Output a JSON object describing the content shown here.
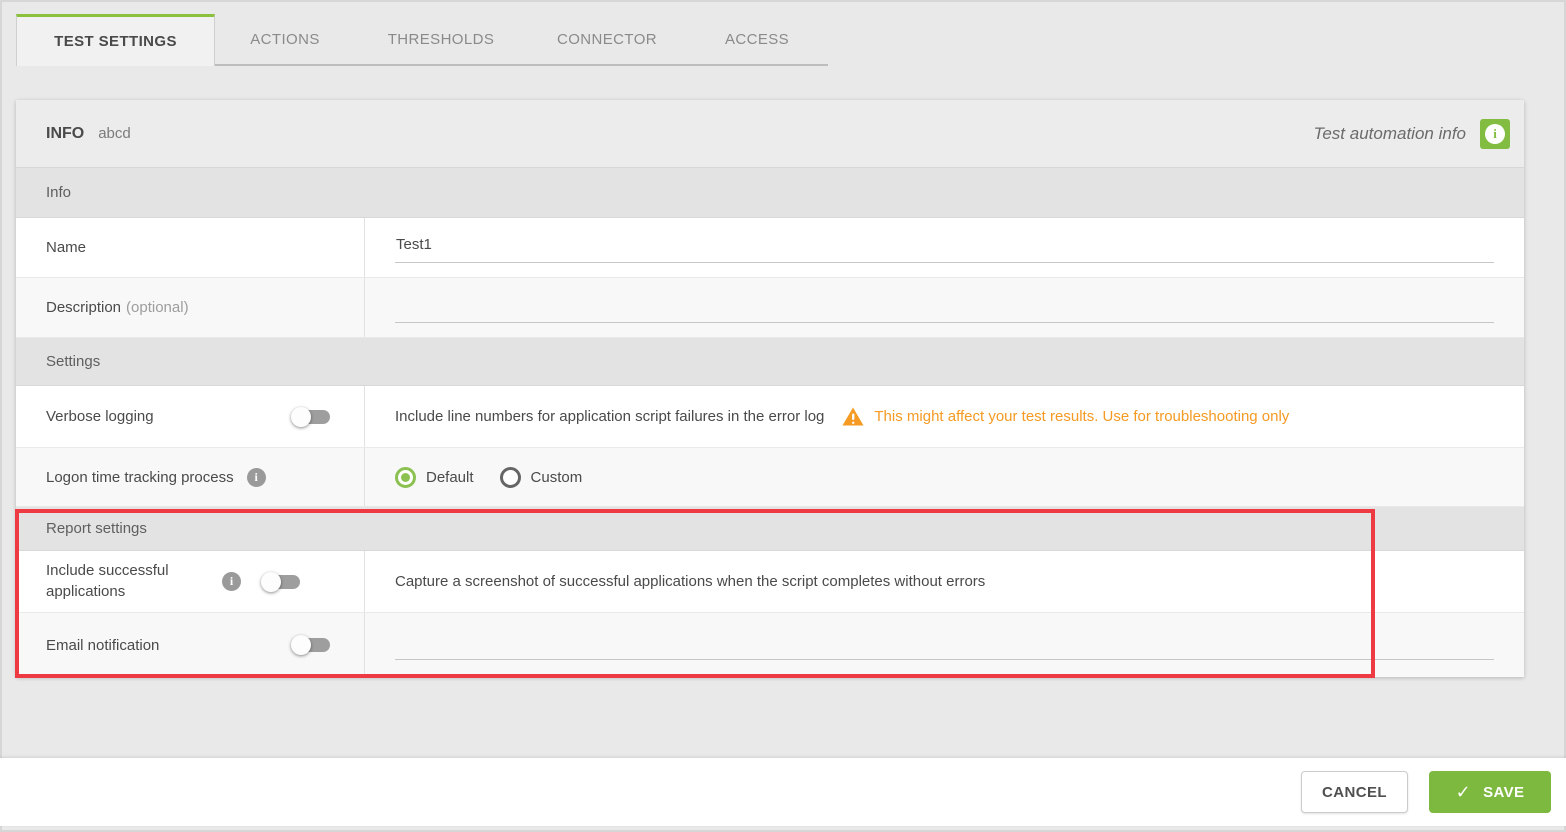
{
  "tabs": [
    {
      "label": "TEST SETTINGS",
      "active": true
    },
    {
      "label": "ACTIONS",
      "active": false
    },
    {
      "label": "THRESHOLDS",
      "active": false
    },
    {
      "label": "CONNECTOR",
      "active": false
    },
    {
      "label": "ACCESS",
      "active": false
    }
  ],
  "panel_header": {
    "title": "INFO",
    "subtitle": "abcd",
    "hint": "Test automation info"
  },
  "sections": {
    "info": "Info",
    "settings": "Settings",
    "report": "Report settings"
  },
  "fields": {
    "name": {
      "label": "Name",
      "value": "Test1"
    },
    "description": {
      "label": "Description",
      "optional": "(optional)",
      "value": ""
    },
    "verbose": {
      "label": "Verbose logging",
      "toggle": "off",
      "description": "Include line numbers for application script failures in the error log",
      "warning": "This might affect your test results. Use for troubleshooting only"
    },
    "logon": {
      "label": "Logon time tracking process",
      "options": [
        {
          "label": "Default",
          "selected": true
        },
        {
          "label": "Custom",
          "selected": false
        }
      ]
    },
    "include_successful": {
      "label": "Include successful applications",
      "toggle": "off",
      "description": "Capture a screenshot of successful applications when the script completes without errors"
    },
    "email": {
      "label": "Email notification",
      "toggle": "off",
      "value": ""
    }
  },
  "footer": {
    "cancel": "CANCEL",
    "save": "SAVE",
    "save_check": "✓"
  },
  "colors": {
    "accent_green": "#82bd41",
    "warning_orange": "#f59a23",
    "highlight_red": "#ee3a43"
  }
}
